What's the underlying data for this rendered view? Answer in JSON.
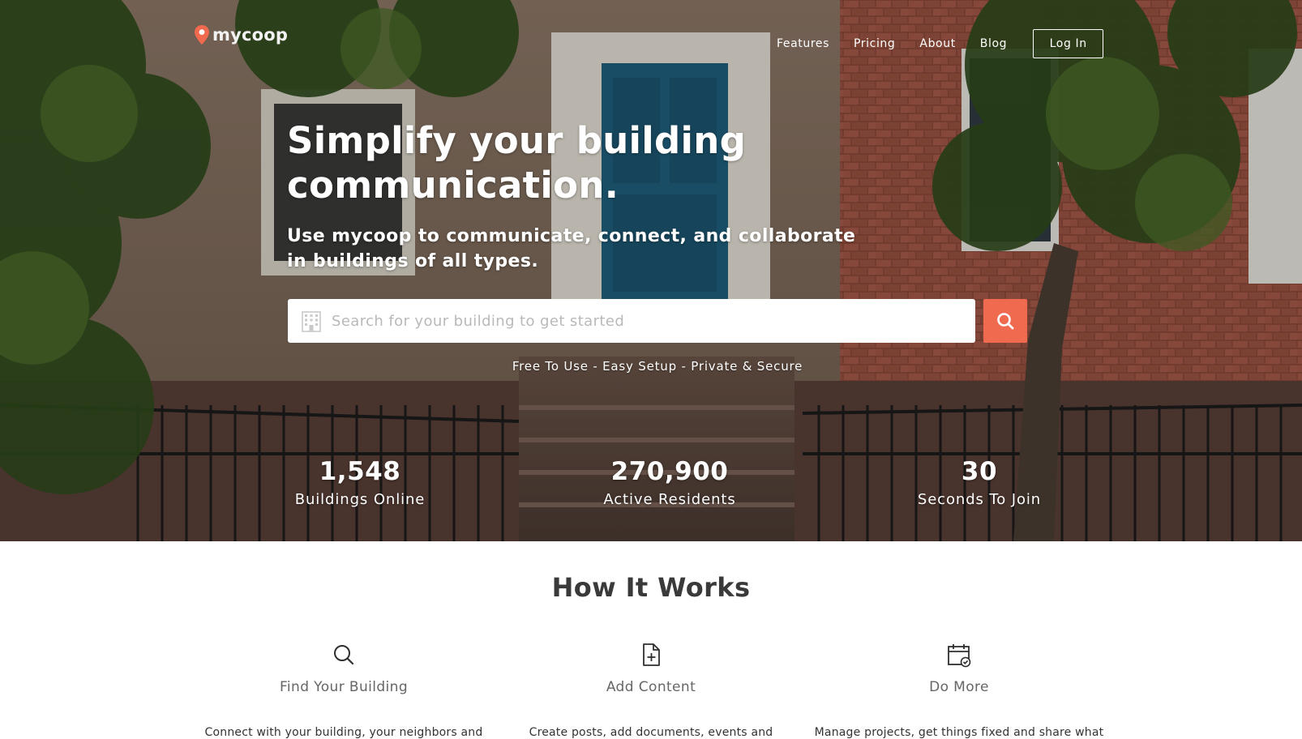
{
  "brand": {
    "name": "mycoop",
    "accent": "#ef6a4f"
  },
  "nav": {
    "links": [
      "Features",
      "Pricing",
      "About",
      "Blog"
    ],
    "login_label": "Log In"
  },
  "hero": {
    "headline": "Simplify your building communication.",
    "subheadline": "Use mycoop to communicate, connect, and collaborate in buildings of all types.",
    "search": {
      "placeholder": "Search for your building to get started",
      "value": "",
      "icon": "building-icon",
      "button_icon": "search-icon"
    },
    "tagline": "Free To Use - Easy Setup - Private & Secure"
  },
  "stats": [
    {
      "value": "1,548",
      "label": "Buildings Online"
    },
    {
      "value": "270,900",
      "label": "Active Residents"
    },
    {
      "value": "30",
      "label": "Seconds To Join"
    }
  ],
  "how_it_works": {
    "title": "How It Works",
    "steps": [
      {
        "icon": "search-icon",
        "title": "Find Your Building",
        "description": "Connect with your building, your neighbors and"
      },
      {
        "icon": "add-document-icon",
        "title": "Add Content",
        "description": "Create posts, add documents, events and"
      },
      {
        "icon": "calendar-check-icon",
        "title": "Do More",
        "description": "Manage projects, get things fixed and share what"
      }
    ]
  }
}
